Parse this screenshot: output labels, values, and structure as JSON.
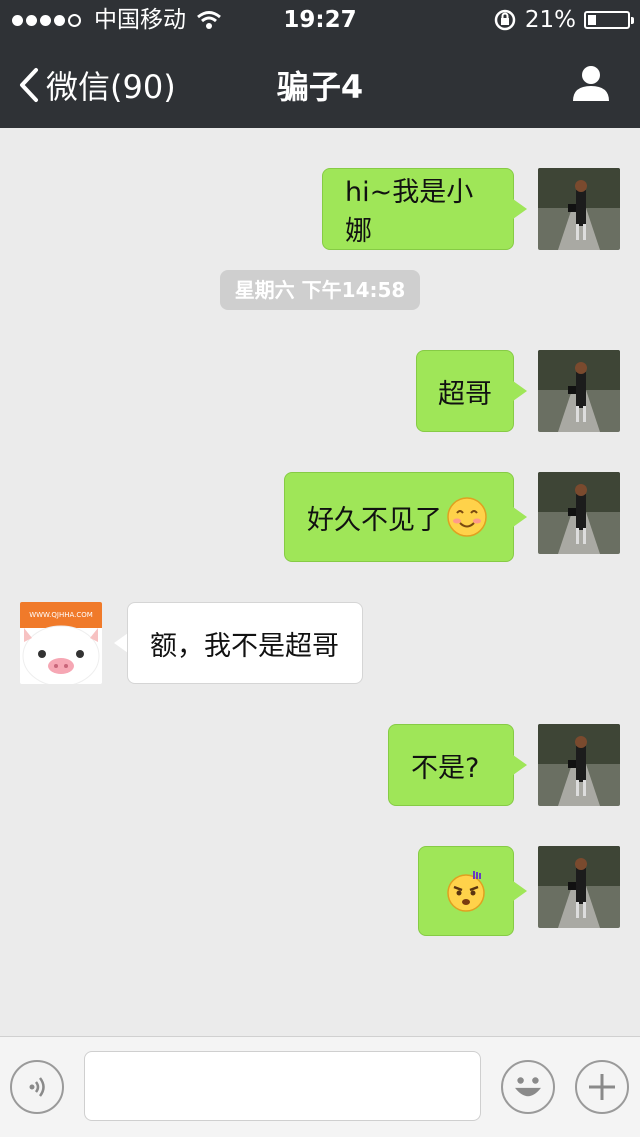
{
  "status_bar": {
    "carrier": "中国移动",
    "time": "19:27",
    "battery_percent": "21%",
    "battery_level": 0.21,
    "signal_bars_filled": 4,
    "signal_bars_total": 5
  },
  "nav": {
    "back_label": "微信(90)",
    "title": "骗子4"
  },
  "messages": [
    {
      "from": "me",
      "text": "hi~我是小娜"
    },
    {
      "from": "me",
      "text": "超哥"
    },
    {
      "from": "me",
      "text": "好久不见了",
      "emoji": "smile-emoji"
    },
    {
      "from": "them",
      "text": "额，我不是超哥"
    },
    {
      "from": "me",
      "text": "不是?"
    },
    {
      "from": "me",
      "text": "",
      "emoji": "angry-emoji"
    }
  ],
  "timestamp": "星期六 下午14:58",
  "avatars": {
    "them_watermark": "WWW.QJHHA.COM"
  },
  "input": {
    "voice_icon": "voice-icon",
    "emoji_icon": "emoji-face-icon",
    "plus_icon": "plus-icon"
  },
  "colors": {
    "header": "#2f3236",
    "chat_bg": "#ebebeb",
    "my_bubble": "#9fe658",
    "their_bubble": "#ffffff",
    "timestamp_bg": "#cfcfcf"
  }
}
